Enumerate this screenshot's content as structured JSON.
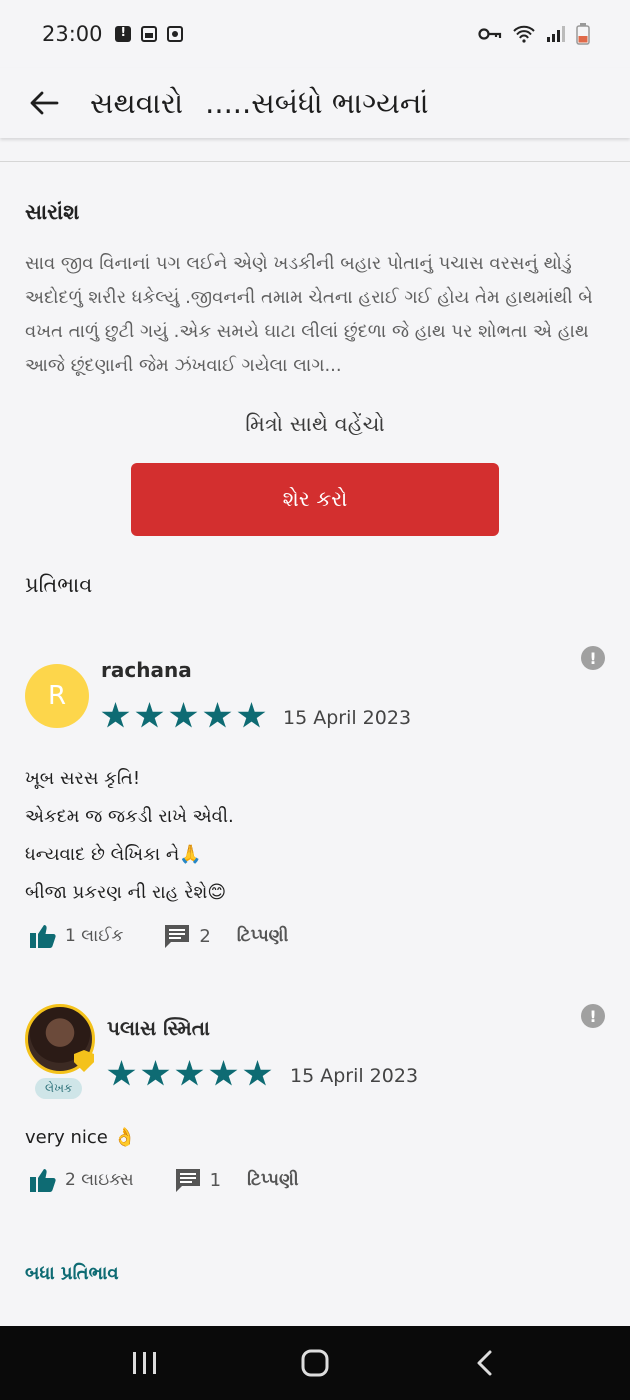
{
  "status_bar": {
    "time": "23:00",
    "icons_left": [
      "alert-icon",
      "image-icon",
      "record-icon"
    ],
    "icons_right": [
      "key-icon",
      "wifi-icon",
      "signal-icon",
      "battery-icon"
    ]
  },
  "header": {
    "title_part1": "સથવારો",
    "title_part2": ".....સબંધો ભાગ્યનાં"
  },
  "summary": {
    "heading": "સારાંશ",
    "text": "સાવ  જીવ વિનાનાં પગ લઈને એણે ખડકીની બહાર પોતાનું પચાસ વરસનું થોડું અદોદળું શરીર ધકેલ્યું .જીવનની તમામ ચેતના હરાઈ ગઈ હોય તેમ હાથમાંથી બે વખત તાળું છુટી ગયું .એક સમયે ઘાટા લીલાં છુંદળા જે હાથ પર શોભતા એ હાથ આજે છૂંદણાની જેમ ઝંખવાઈ ગયેલા લાગ..."
  },
  "share": {
    "label": "મિત્રો સાથે વહેંચો",
    "button_label": "શેર કરો"
  },
  "responses": {
    "heading": "પ્રતિભાવ",
    "all_link": "બધા પ્રતિભાવ",
    "items": [
      {
        "avatar_letter": "R",
        "name": "rachana",
        "rating": 5,
        "date": "15 April 2023",
        "body": "ખૂબ સરસ કૃતિ!\nએકદમ જ જકડી રાખે એવી.\nધન્યવાદ છે લેખિકા ને🙏\nબીજા પ્રકરણ ની રાહ રેશે😊",
        "likes_label": "1 લાઈક",
        "comments_count": "2",
        "comments_label": "ટિપ્પણી",
        "report_glyph": "!"
      },
      {
        "author_badge": "લેખક",
        "name": "પલાસ સ્મિતા",
        "rating": 5,
        "date": "15 April 2023",
        "body": "very nice 👌",
        "likes_label": "2 લાઇક્સ",
        "comments_count": "1",
        "comments_label": "ટિપ્પણી",
        "report_glyph": "!"
      }
    ]
  },
  "nav": {
    "buttons": [
      "recents-icon",
      "home-icon",
      "back-icon"
    ]
  },
  "colors": {
    "accent": "#0e6b73",
    "share_button": "#d32f2f",
    "avatar_letter_bg": "#fdd64b",
    "author_badge_bg": "#cfe5e8"
  }
}
